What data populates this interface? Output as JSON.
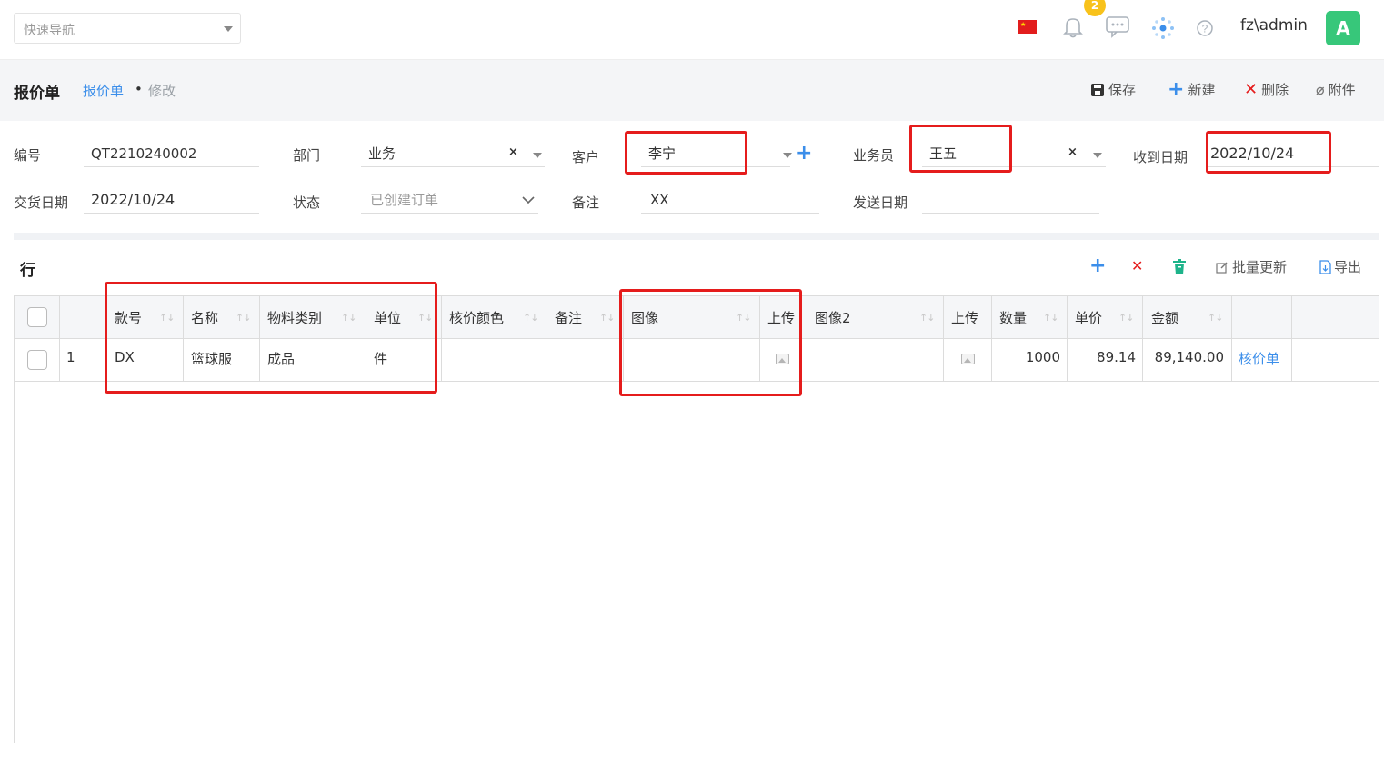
{
  "topbar": {
    "quicknav_placeholder": "快速导航",
    "notification_count": "2",
    "user": "fz\\admin",
    "avatar_letter": "A"
  },
  "titlebar": {
    "title": "报价单",
    "breadcrumb_link": "报价单",
    "breadcrumb_sep": "•",
    "breadcrumb_current": "修改",
    "buttons": {
      "save": "保存",
      "new": "新建",
      "delete": "删除",
      "attach": "附件"
    }
  },
  "form": {
    "code_label": "编号",
    "code_value": "QT2210240002",
    "dept_label": "部门",
    "dept_value": "业务",
    "customer_label": "客户",
    "customer_value": "李宁",
    "salesman_label": "业务员",
    "salesman_value": "王五",
    "received_label": "收到日期",
    "received_value": "2022/10/24",
    "delivery_label": "交货日期",
    "delivery_value": "2022/10/24",
    "status_label": "状态",
    "status_value": "已创建订单",
    "remark_label": "备注",
    "remark_value": "XX",
    "send_label": "发送日期",
    "send_value": ""
  },
  "lines": {
    "title": "行",
    "batch_update": "批量更新",
    "export": "导出",
    "columns": [
      "款号",
      "名称",
      "物料类别",
      "单位",
      "核价颜色",
      "备注",
      "图像",
      "上传",
      "图像2",
      "上传",
      "数量",
      "单价",
      "金额"
    ],
    "rows": [
      {
        "no": "1",
        "style": "DX",
        "name": "篮球服",
        "category": "成品",
        "unit": "件",
        "color": "",
        "remark": "",
        "image": "",
        "image2": "",
        "qty": "1000",
        "price": "89.14",
        "amount": "89,140.00",
        "link": "核价单"
      }
    ]
  },
  "colors": {
    "accent": "#3b8eea",
    "highlight": "#e51c1c",
    "avatar": "#37c77a",
    "badge": "#f8c21b"
  }
}
